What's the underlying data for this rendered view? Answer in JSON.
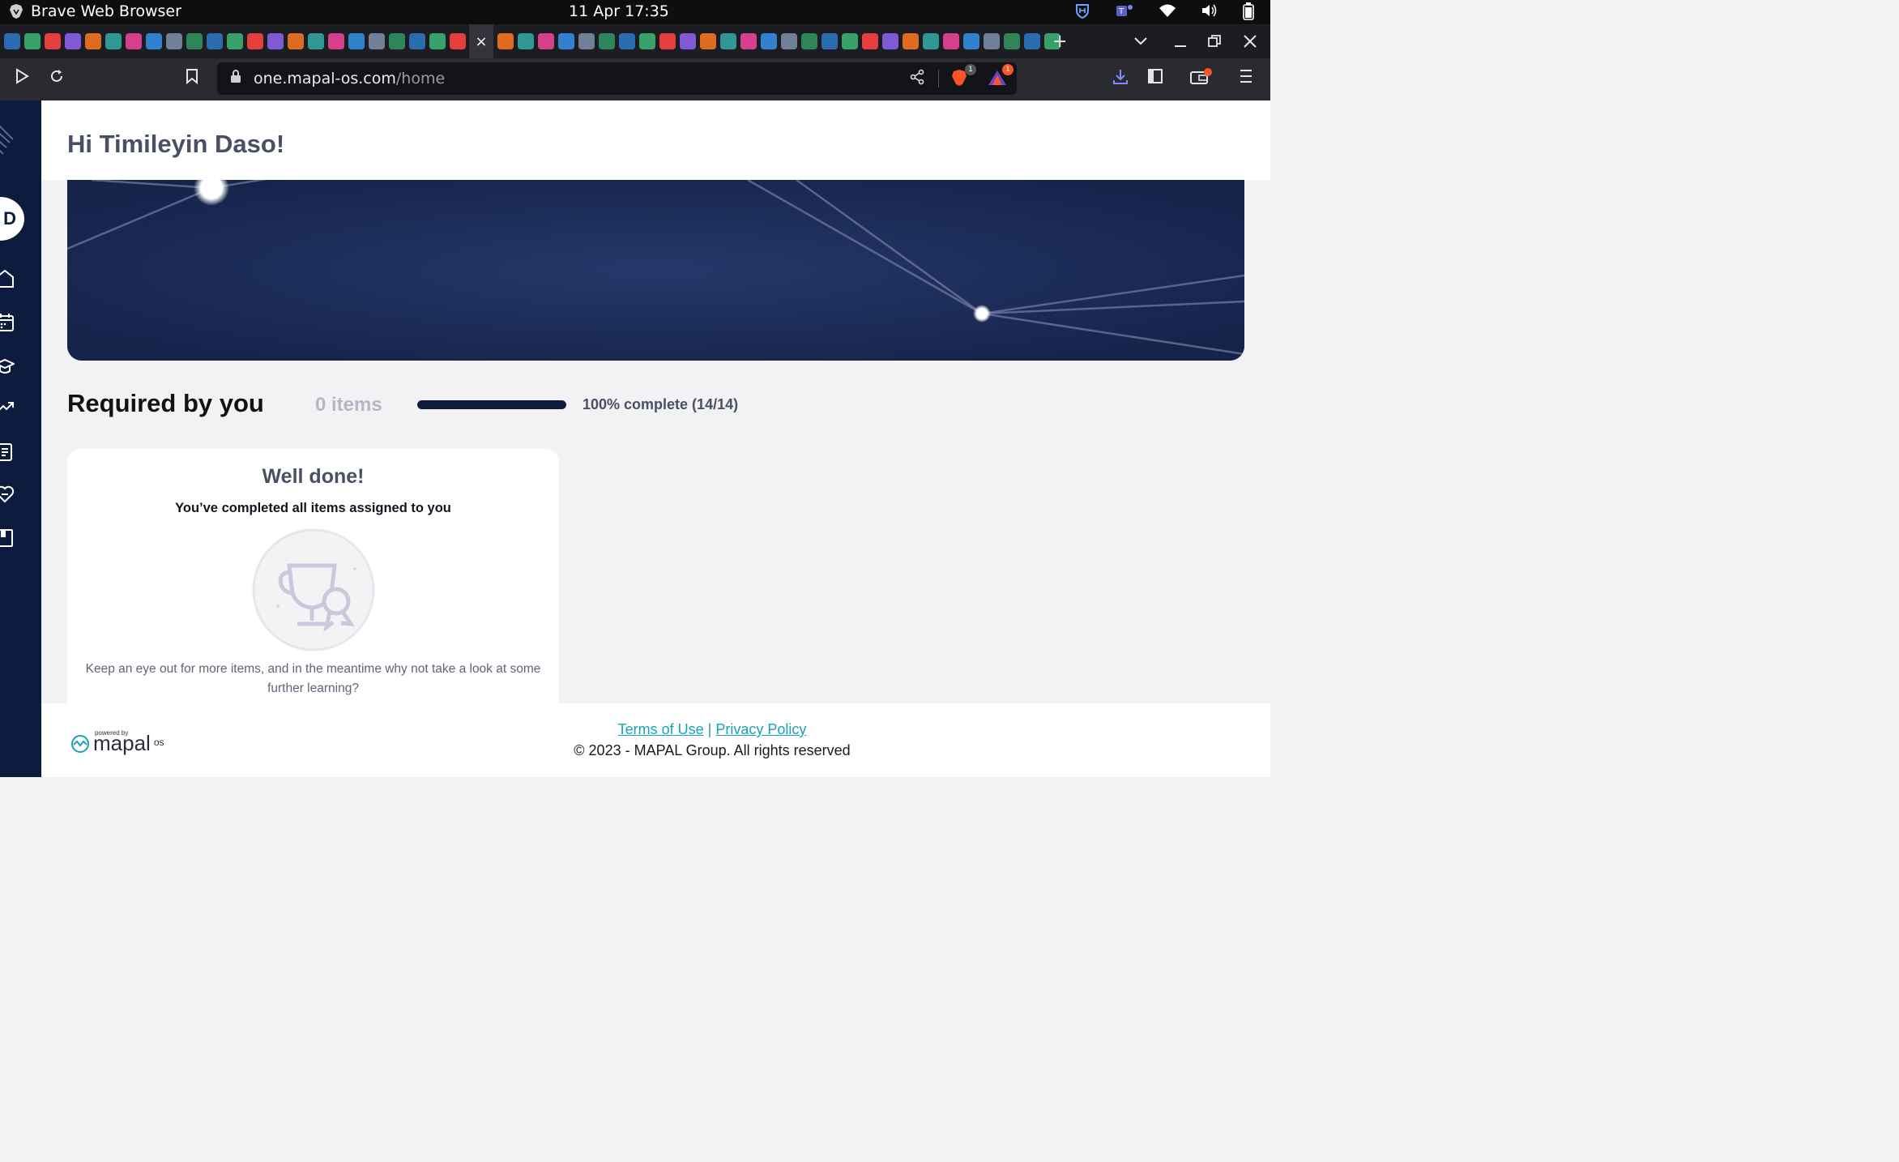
{
  "os": {
    "app_name": "Brave Web Browser",
    "clock": "11 Apr  17:35"
  },
  "tabs": {
    "favicons": [
      "dj",
      "leaf",
      "JD",
      "M",
      "i",
      "i",
      "i",
      "globe",
      "outlook",
      "Y",
      "dj",
      "in",
      "slack",
      "B",
      "ledger",
      "A",
      "dots",
      "outlook2",
      "cisco",
      "365",
      "M",
      "globe",
      "G",
      "active",
      "M",
      "S",
      "drive",
      "cisco",
      "cisco2",
      "C",
      "cube",
      "dj",
      "twitter",
      "python",
      "github",
      "x",
      "youtube",
      "y",
      "globe",
      "so",
      "green",
      "v",
      "gpt",
      "keyboard",
      "U",
      "i",
      "plus",
      "office",
      "office",
      "gpt",
      "office",
      "brave"
    ],
    "active_close": "×"
  },
  "browser": {
    "url_host": "one.mapal-os.com",
    "url_path": "/home",
    "brave_shield_badge": "1",
    "rewards_badge": "1"
  },
  "sidebar": {
    "avatar_letter": "D"
  },
  "header": {
    "greeting": "Hi Timileyin Daso!"
  },
  "required": {
    "title": "Required by you",
    "count_label": "0 items",
    "progress_fraction": 1.0,
    "progress_text": "100% complete (14/14)"
  },
  "card": {
    "title": "Well done!",
    "subtitle": "You’ve completed all items assigned to you",
    "description": "Keep an eye out for more items, and in the meantime why not take a look at some further learning?"
  },
  "footer": {
    "powered_by": "powered by",
    "brand": "mapal",
    "brand_suffix": "os",
    "terms": "Terms of Use",
    "separator": "|",
    "privacy": "Privacy Policy",
    "copyright": "© 2023 - MAPAL Group. All rights reserved"
  }
}
